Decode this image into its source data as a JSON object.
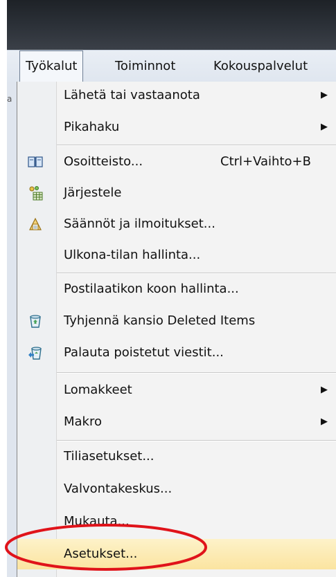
{
  "menubar": {
    "items": [
      {
        "label": "Työkalut",
        "active": true
      },
      {
        "label": "Toiminnot",
        "active": false
      },
      {
        "label": "Kokouspalvelut",
        "active": false
      }
    ]
  },
  "left_strip_text": "a",
  "menu": {
    "items": [
      {
        "label": "Lähetä tai vastaanota",
        "submenu": true
      },
      {
        "label": "Pikahaku",
        "submenu": true
      },
      {
        "label": "Osoitteisto...",
        "shortcut": "Ctrl+Vaihto+B",
        "icon": "address-book-icon"
      },
      {
        "label": "Järjestele",
        "icon": "organize-icon"
      },
      {
        "label": "Säännöt ja ilmoitukset...",
        "icon": "rules-icon"
      },
      {
        "label": "Ulkona-tilan hallinta..."
      },
      {
        "label": "Postilaatikon koon hallinta..."
      },
      {
        "label": "Tyhjennä kansio Deleted Items",
        "icon": "empty-trash-icon"
      },
      {
        "label": "Palauta poistetut viestit...",
        "icon": "recover-deleted-icon"
      },
      {
        "label": "Lomakkeet",
        "submenu": true
      },
      {
        "label": "Makro",
        "submenu": true
      },
      {
        "label": "Tiliasetukset..."
      },
      {
        "label": "Valvontakeskus..."
      },
      {
        "label": "Mukauta..."
      },
      {
        "label": "Asetukset...",
        "highlighted": true
      }
    ],
    "submenu_arrow": "▶"
  },
  "colors": {
    "highlight": "#fbe4a0",
    "annotation_circle": "#e0131a"
  }
}
